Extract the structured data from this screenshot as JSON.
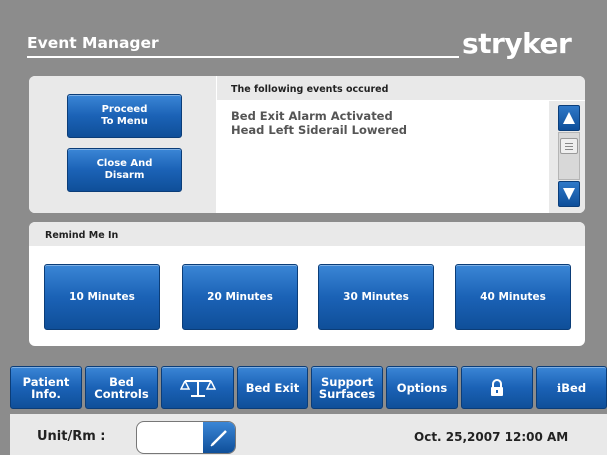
{
  "header": {
    "title": "Event Manager",
    "brand": "stryker"
  },
  "actions": {
    "proceed_label_1": "Proceed",
    "proceed_label_2": "To Menu",
    "close_label_1": "Close And",
    "close_label_2": "Disarm"
  },
  "events": {
    "header": "The following events occured",
    "items": [
      "Bed Exit Alarm Activated",
      "Head Left Siderail Lowered"
    ]
  },
  "remind": {
    "header": "Remind Me In",
    "options": [
      "10 Minutes",
      "20 Minutes",
      "30 Minutes",
      "40 Minutes"
    ]
  },
  "nav": {
    "patient_1": "Patient",
    "patient_2": "Info.",
    "bed_controls_1": "Bed",
    "bed_controls_2": "Controls",
    "scale_icon": "scale-icon",
    "bed_exit": "Bed Exit",
    "support_1": "Support",
    "support_2": "Surfaces",
    "options": "Options",
    "lock_icon": "lock-icon",
    "ibed": "ℹBed"
  },
  "status": {
    "unit_label": "Unit/Rm :",
    "unit_value": "",
    "datetime": "Oct. 25,2007  12:00 AM"
  },
  "colors": {
    "background": "#8c8c8c",
    "button_blue": "#1b62b6",
    "panel": "#ffffff"
  }
}
